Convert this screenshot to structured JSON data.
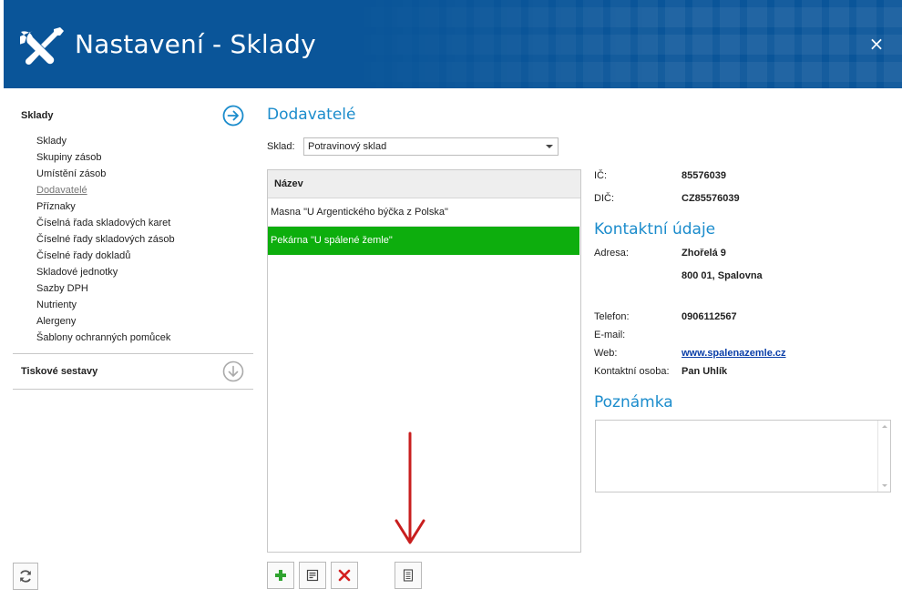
{
  "window": {
    "title": "Nastavení - Sklady",
    "close_label": "×"
  },
  "nav": {
    "sections": [
      {
        "label": "Sklady",
        "items": [
          {
            "label": "Sklady"
          },
          {
            "label": "Skupiny zásob"
          },
          {
            "label": "Umístění zásob"
          },
          {
            "label": "Dodavatelé",
            "active": true
          },
          {
            "label": "Příznaky"
          },
          {
            "label": "Číselná řada skladových karet"
          },
          {
            "label": "Číselné řady skladových zásob"
          },
          {
            "label": "Číselné řady dokladů"
          },
          {
            "label": "Skladové jednotky"
          },
          {
            "label": "Sazby DPH"
          },
          {
            "label": "Nutrienty"
          },
          {
            "label": "Alergeny"
          },
          {
            "label": "Šablony ochranných pomůcek"
          }
        ]
      },
      {
        "label": "Tiskové sestavy"
      }
    ]
  },
  "main": {
    "title": "Dodavatelé",
    "sklad_label": "Sklad:",
    "sklad_value": "Potravinový sklad",
    "grid": {
      "column_header": "Název",
      "rows": [
        {
          "name": "Masna \"U Argentického býčka z Polska\"",
          "selected": false
        },
        {
          "name": "Pekárna \"U spálené žemle\"",
          "selected": true
        }
      ]
    }
  },
  "details": {
    "ic_label": "IČ:",
    "ic_value": "85576039",
    "dic_label": "DIČ:",
    "dic_value": "CZ85576039",
    "contact_title": "Kontaktní údaje",
    "address_label": "Adresa:",
    "address_line1": "Zhořelá 9",
    "address_line2": "800 01, Spalovna",
    "phone_label": "Telefon:",
    "phone_value": "0906112567",
    "email_label": "E-mail:",
    "email_value": "",
    "web_label": "Web:",
    "web_value": "www.spalenazemle.cz",
    "person_label": "Kontaktní osoba:",
    "person_value": "Pan Uhlík",
    "note_title": "Poznámka",
    "note_value": ""
  },
  "colors": {
    "header_bg": "#0a5599",
    "accent": "#1b8ccc",
    "selected_row": "#0dae0d",
    "add_icon": "#2fa32f",
    "delete_icon": "#d42020",
    "annotation_arrow": "#c81e1e"
  },
  "icons": {
    "header": "tools-icon",
    "sklady_section": "arrow-right-circle-icon",
    "tiskove_section": "arrow-down-circle-icon",
    "refresh": "refresh-icon",
    "add": "plus-icon",
    "edit": "edit-document-icon",
    "delete": "x-icon",
    "detail": "document-icon"
  }
}
